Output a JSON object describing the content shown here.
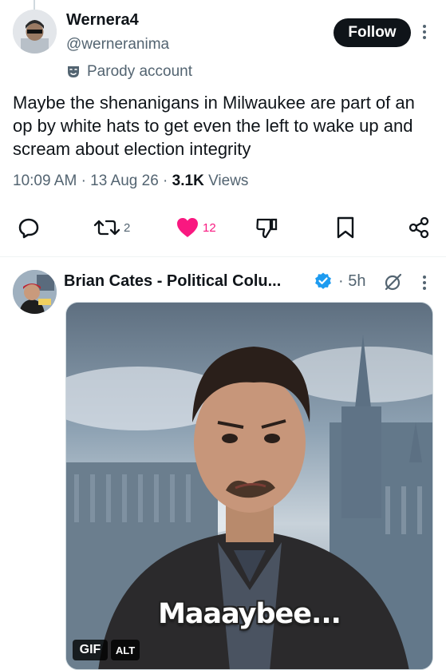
{
  "post1": {
    "display_name": "Wernera4",
    "handle": "@werneranima",
    "follow_label": "Follow",
    "parody_label": "Parody account",
    "text": "Maybe the shenanigans in Milwaukee are part of an op by white hats to get even the left to wake up and scream about election integrity",
    "time": "10:09 AM",
    "date": "13 Aug 26",
    "views_count": "3.1K",
    "views_label": "Views",
    "separator": "·",
    "actions": {
      "reply_icon": "reply-icon",
      "repost_icon": "repost-icon",
      "repost_count": "2",
      "like_icon": "heart-filled-icon",
      "like_count": "12",
      "dislike_icon": "dislike-icon",
      "bookmark_icon": "bookmark-icon",
      "share_icon": "share-icon"
    },
    "colors": {
      "like": "#f91880",
      "secondary_text": "#536471",
      "primary_text": "#0f1419"
    }
  },
  "post2": {
    "display_name": "Brian Cates - Political Colu...",
    "verified_icon": "verified-badge-icon",
    "verified_color": "#1d9bf0",
    "time_separator": "·",
    "time": "5h",
    "grok_icon": "grok-icon",
    "media": {
      "caption": "Maaaybee...",
      "gif_badge": "GIF",
      "alt_badge": "ALT"
    }
  }
}
